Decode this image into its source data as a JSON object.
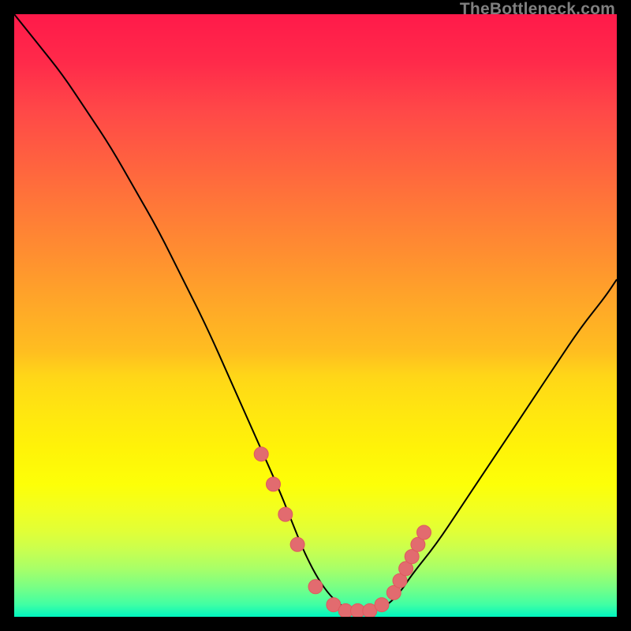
{
  "watermark_text": "TheBottleneck.com",
  "colors": {
    "frame": "#000000",
    "curve": "#000000",
    "marker": "#e26b6f",
    "marker_stroke": "#de5a5e"
  },
  "chart_data": {
    "type": "line",
    "title": "",
    "xlabel": "",
    "ylabel": "",
    "xlim": [
      0,
      100
    ],
    "ylim": [
      0,
      100
    ],
    "series": [
      {
        "name": "bottleneck-curve",
        "x": [
          0,
          4,
          8,
          12,
          16,
          20,
          24,
          28,
          32,
          36,
          40,
          44,
          46,
          48,
          50,
          52,
          54,
          56,
          58,
          60,
          62,
          64,
          66,
          70,
          74,
          78,
          82,
          86,
          90,
          94,
          98,
          100
        ],
        "y": [
          100,
          95,
          90,
          84,
          78,
          71,
          64,
          56,
          48,
          39,
          30,
          21,
          16,
          11,
          7,
          4,
          2,
          1,
          1,
          1,
          2,
          4,
          7,
          12,
          18,
          24,
          30,
          36,
          42,
          48,
          53,
          56
        ]
      }
    ],
    "markers": {
      "name": "highlighted-points",
      "x": [
        41,
        43,
        45,
        47,
        50,
        53,
        55,
        57,
        59,
        61,
        63,
        64,
        65,
        66,
        67,
        68
      ],
      "y": [
        27,
        22,
        17,
        12,
        5,
        2,
        1,
        1,
        1,
        2,
        4,
        6,
        8,
        10,
        12,
        14
      ]
    }
  }
}
